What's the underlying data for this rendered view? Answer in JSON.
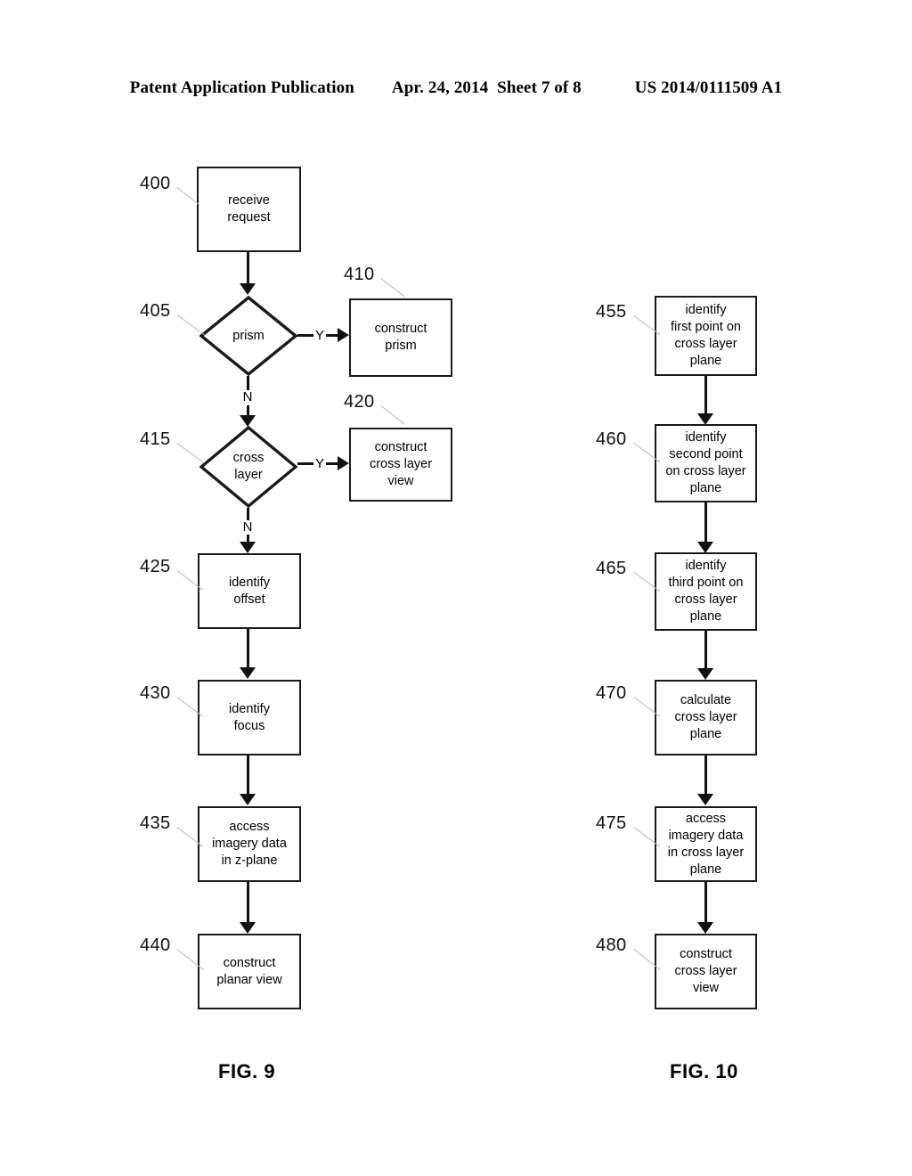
{
  "header": {
    "publication": "Patent Application Publication",
    "date": "Apr. 24, 2014",
    "sheet": "Sheet 7 of 8",
    "patent_number": "US 2014/0111509 A1"
  },
  "figures": [
    {
      "caption": "FIG. 9",
      "nodes": [
        {
          "ref": "400",
          "type": "process",
          "label": "receive\nrequest"
        },
        {
          "ref": "405",
          "type": "decision",
          "label": "prism"
        },
        {
          "ref": "410",
          "type": "process",
          "label": "construct\nprism"
        },
        {
          "ref": "415",
          "type": "decision",
          "label": "cross\nlayer"
        },
        {
          "ref": "420",
          "type": "process",
          "label": "construct\ncross layer\nview"
        },
        {
          "ref": "425",
          "type": "process",
          "label": "identify\noffset"
        },
        {
          "ref": "430",
          "type": "process",
          "label": "identify\nfocus"
        },
        {
          "ref": "435",
          "type": "process",
          "label": "access\nimagery data\nin z-plane"
        },
        {
          "ref": "440",
          "type": "process",
          "label": "construct\nplanar view"
        }
      ],
      "branch_labels": {
        "prism_yes": "Y",
        "prism_no": "N",
        "cross_layer_yes": "Y",
        "cross_layer_no": "N"
      }
    },
    {
      "caption": "FIG. 10",
      "nodes": [
        {
          "ref": "455",
          "type": "process",
          "label": "identify\nfirst point on\ncross layer\nplane"
        },
        {
          "ref": "460",
          "type": "process",
          "label": "identify\nsecond point\non cross layer\nplane"
        },
        {
          "ref": "465",
          "type": "process",
          "label": "identify\nthird point on\ncross layer\nplane"
        },
        {
          "ref": "470",
          "type": "process",
          "label": "calculate\ncross layer\nplane"
        },
        {
          "ref": "475",
          "type": "process",
          "label": "access\nimagery data\nin cross layer\nplane"
        },
        {
          "ref": "480",
          "type": "process",
          "label": "construct\ncross layer\nview"
        }
      ]
    }
  ],
  "labels": {
    "fig9_caption": "FIG. 9",
    "fig10_caption": "FIG. 10",
    "n400": "400",
    "n405": "405",
    "n410": "410",
    "n415": "415",
    "n420": "420",
    "n425": "425",
    "n430": "430",
    "n435": "435",
    "n440": "440",
    "n455": "455",
    "n460": "460",
    "n465": "465",
    "n470": "470",
    "n475": "475",
    "n480": "480",
    "t400": "receive\nrequest",
    "t405": "prism",
    "t410": "construct\nprism",
    "t415": "cross\nlayer",
    "t420": "construct\ncross layer\nview",
    "t425": "identify\noffset",
    "t430": "identify\nfocus",
    "t435": "access\nimagery data\nin z-plane",
    "t440": "construct\nplanar view",
    "t455": "identify\nfirst point on\ncross layer\nplane",
    "t460": "identify\nsecond point\non cross layer\nplane",
    "t465": "identify\nthird point on\ncross layer\nplane",
    "t470": "calculate\ncross layer\nplane",
    "t475": "access\nimagery data\nin cross layer\nplane",
    "t480": "construct\ncross layer\nview",
    "yes1": "Y",
    "no1": "N",
    "yes2": "Y",
    "no2": "N"
  },
  "colors": {
    "ink": "#111111",
    "paper": "#ffffff",
    "leader": "#b9b9b9"
  }
}
